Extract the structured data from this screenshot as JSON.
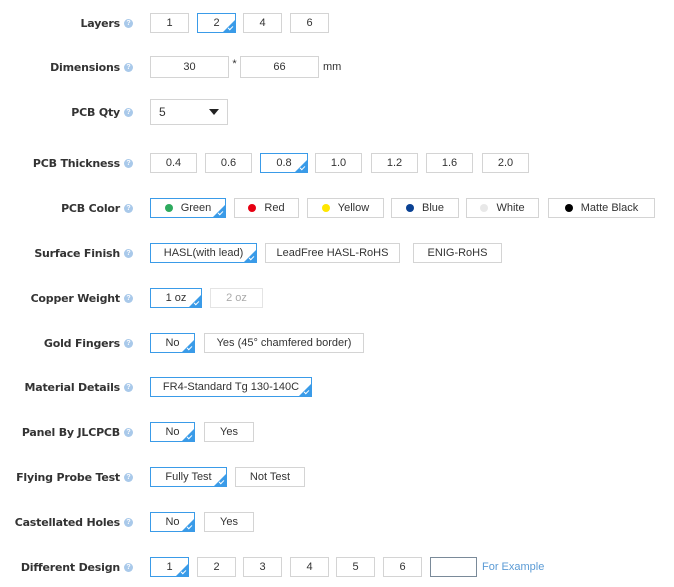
{
  "help_icon": "question-circle-icon",
  "accent_color": "#3a9be8",
  "rows": [
    {
      "label": "Layers",
      "type": "buttons",
      "options": [
        "1",
        "2",
        "4",
        "6"
      ],
      "selected": 1
    },
    {
      "label": "Dimensions",
      "type": "dimensions",
      "width": "30",
      "height": "66",
      "separator": "*",
      "unit": "mm"
    },
    {
      "label": "PCB Qty",
      "type": "select",
      "value": "5"
    },
    {
      "label": "PCB Thickness",
      "type": "buttons",
      "options": [
        "0.4",
        "0.6",
        "0.8",
        "1.0",
        "1.2",
        "1.6",
        "2.0"
      ],
      "selected": 2
    },
    {
      "label": "PCB Color",
      "type": "colors",
      "options": [
        {
          "label": "Green",
          "color": "#2eaa5e"
        },
        {
          "label": "Red",
          "color": "#e60012"
        },
        {
          "label": "Yellow",
          "color": "#ffe600"
        },
        {
          "label": "Blue",
          "color": "#0a4193"
        },
        {
          "label": "White",
          "color": "#e8e8e8"
        },
        {
          "label": "Matte Black",
          "color": "#000000"
        }
      ],
      "selected": 0
    },
    {
      "label": "Surface Finish",
      "type": "buttons",
      "options": [
        "HASL(with lead)",
        "LeadFree HASL-RoHS",
        "ENIG-RoHS"
      ],
      "selected": 0
    },
    {
      "label": "Copper Weight",
      "type": "buttons",
      "options": [
        "1 oz",
        "2 oz"
      ],
      "selected": 0,
      "disabled": [
        1
      ]
    },
    {
      "label": "Gold Fingers",
      "type": "buttons",
      "options": [
        "No",
        "Yes (45° chamfered border)"
      ],
      "selected": 0
    },
    {
      "label": "Material Details",
      "type": "buttons",
      "options": [
        "FR4-Standard Tg 130-140C"
      ],
      "selected": 0
    },
    {
      "label": "Panel By JLCPCB",
      "type": "buttons",
      "options": [
        "No",
        "Yes"
      ],
      "selected": 0
    },
    {
      "label": "Flying Probe Test",
      "type": "buttons",
      "options": [
        "Fully Test",
        "Not Test"
      ],
      "selected": 0
    },
    {
      "label": "Castellated Holes",
      "type": "buttons",
      "options": [
        "No",
        "Yes"
      ],
      "selected": 0
    },
    {
      "label": "Different Design",
      "type": "buttons",
      "options": [
        "1",
        "2",
        "3",
        "4",
        "5",
        "6"
      ],
      "selected": 0,
      "custom_value": "",
      "link": "For Example"
    }
  ]
}
